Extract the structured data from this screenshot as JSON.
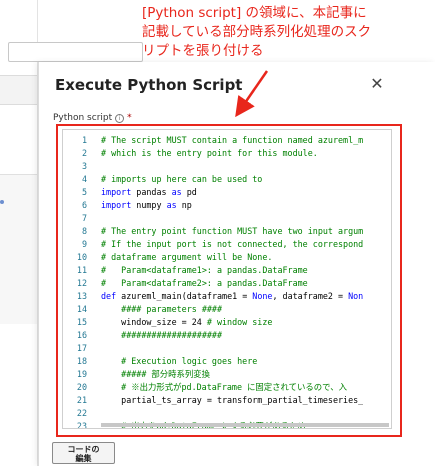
{
  "annotation": {
    "lines": [
      "[Python script] の領域に、本記事に",
      "記載している部分時系列化処理のスク",
      "リプトを張り付ける"
    ],
    "color": "#e8261c"
  },
  "panel": {
    "title": "Execute Python Script",
    "close_icon": "close-icon",
    "field_label": "Python script",
    "info_icon": "info-icon",
    "required_mark": "*"
  },
  "code_lines": [
    {
      "n": "1",
      "text": "# The script MUST contain a function named azureml_m",
      "type": "comment"
    },
    {
      "n": "2",
      "text": "# which is the entry point for this module.",
      "type": "comment"
    },
    {
      "n": "3",
      "text": "",
      "type": "plain"
    },
    {
      "n": "4",
      "text": "# imports up here can be used to",
      "type": "comment"
    },
    {
      "n": "5",
      "kw": "import",
      "text": " pandas ",
      "kw2": "as",
      "text2": " pd",
      "type": "import"
    },
    {
      "n": "6",
      "kw": "import",
      "text": " numpy ",
      "kw2": "as",
      "text2": " np",
      "type": "import"
    },
    {
      "n": "7",
      "text": "",
      "type": "plain"
    },
    {
      "n": "8",
      "text": "# The entry point function MUST have two input argum",
      "type": "comment"
    },
    {
      "n": "9",
      "text": "# If the input port is not connected, the correspond",
      "type": "comment"
    },
    {
      "n": "10",
      "text": "# dataframe argument will be None.",
      "type": "comment"
    },
    {
      "n": "11",
      "text": "#   Param<dataframe1>: a pandas.DataFrame",
      "type": "comment"
    },
    {
      "n": "12",
      "text": "#   Param<dataframe2>: a pandas.DataFrame",
      "type": "comment"
    },
    {
      "n": "13",
      "kw": "def",
      "text": " azureml_main(dataframe1 = ",
      "kw2": "None",
      "text2": ", dataframe2 = ",
      "kw3": "Non",
      "type": "def"
    },
    {
      "n": "14",
      "text": "    #### parameters ####",
      "type": "comment"
    },
    {
      "n": "15",
      "text": "    window_size = 24 # window size",
      "type": "mixed",
      "code": "    window_size = 24 ",
      "comment": "# window size"
    },
    {
      "n": "16",
      "text": "    ####################",
      "type": "comment"
    },
    {
      "n": "17",
      "text": "",
      "type": "plain"
    },
    {
      "n": "18",
      "text": "    # Execution logic goes here",
      "type": "comment"
    },
    {
      "n": "19",
      "text": "    ##### 部分時系列変換",
      "type": "comment"
    },
    {
      "n": "20",
      "text": "    # ※出力形式がpd.DataFrame に固定されているので、入",
      "type": "comment"
    },
    {
      "n": "21",
      "text": "    partial_ts_array = transform_partial_timeseries_",
      "type": "plain"
    },
    {
      "n": "22",
      "text": "",
      "type": "plain"
    },
    {
      "n": "23",
      "text": "    # 出力をpd.DataFrame にする必要があるため",
      "type": "comment"
    }
  ],
  "bottom_button": {
    "label_line1": "コードの",
    "label_line2": "編集"
  }
}
